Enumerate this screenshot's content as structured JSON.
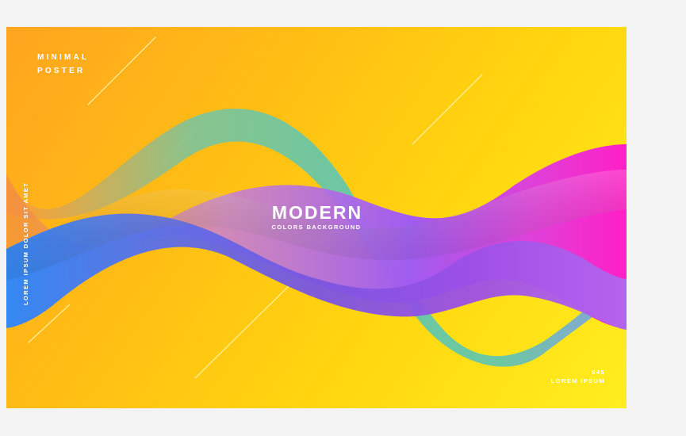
{
  "poster": {
    "top_left": {
      "line1": "MINIMAL",
      "line2": "POSTER"
    },
    "headline": {
      "title": "MODERN",
      "subtitle": "COLORS BACKGROUND"
    },
    "side_text": "LOREM IPSUM DOLOR SIT AMET",
    "bottom_right": {
      "number": "845",
      "label": "LOREM IPSUM"
    },
    "colors": {
      "background_start": "#ffa51f",
      "background_end": "#ffee1f",
      "wave_teal": "#6cc7a3",
      "wave_purple": "#a05cf0",
      "wave_magenta": "#ff1fc6",
      "wave_blue": "#3d7ff5"
    }
  }
}
